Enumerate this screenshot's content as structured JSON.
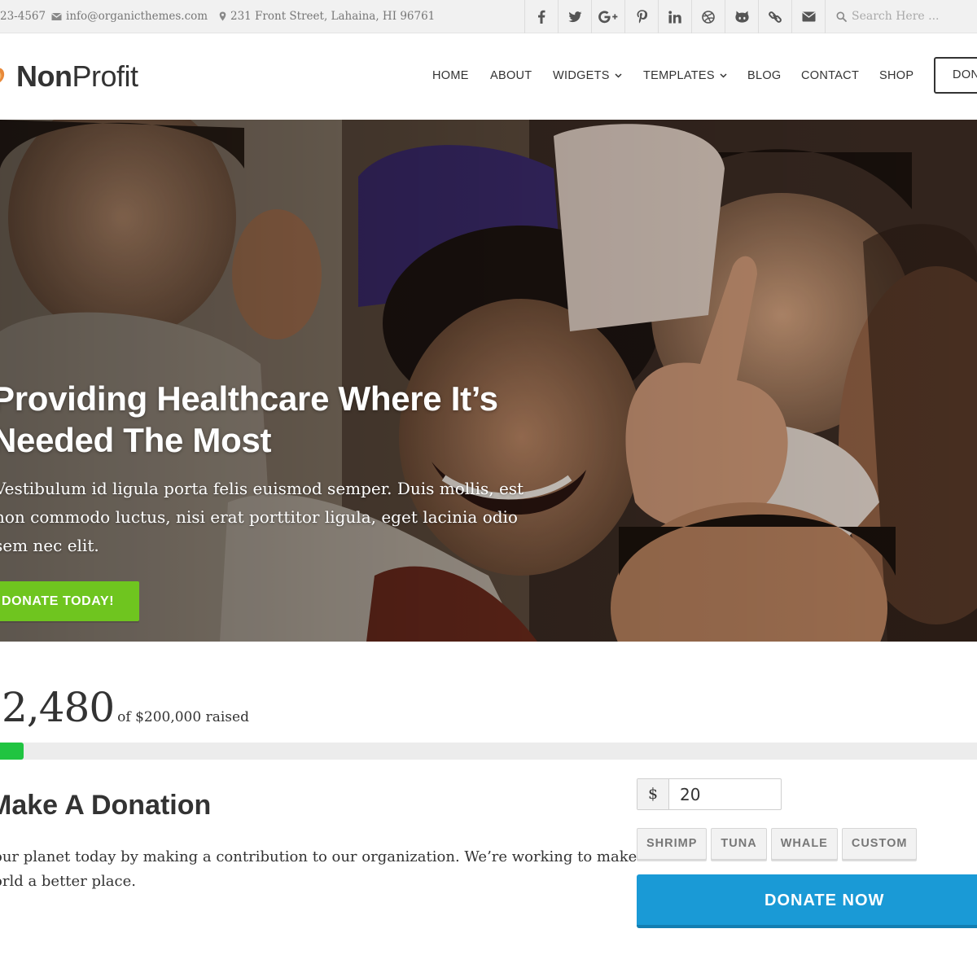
{
  "topbar": {
    "phone": "23-4567",
    "email": "info@organicthemes.com",
    "address": "231 Front Street, Lahaina, HI 96761",
    "social": [
      "facebook-icon",
      "twitter-icon",
      "google-plus-icon",
      "pinterest-icon",
      "linkedin-icon",
      "dribbble-icon",
      "github-icon",
      "link-icon",
      "envelope-icon"
    ],
    "search_placeholder": "Search Here ..."
  },
  "header": {
    "logo_bold": "Non",
    "logo_light": "Profit",
    "nav": {
      "home": "HOME",
      "about": "ABOUT",
      "widgets": "WIDGETS",
      "templates": "TEMPLATES",
      "blog": "BLOG",
      "contact": "CONTACT",
      "shop": "SHOP",
      "donate": "DON"
    }
  },
  "hero": {
    "title_line1": "Providing Healthcare Where It’s",
    "title_line2": "Needed The Most",
    "text_line1": "Vestibulum id ligula porta felis euismod semper. Duis mollis, est",
    "text_line2": "non commodo luctus, nisi erat porttitor ligula, eget lacinia odio",
    "text_line3": "sem nec elit.",
    "button": "DONATE TODAY!"
  },
  "campaign": {
    "raised_display": "2,480",
    "goal_text": "of $200,000 raised",
    "progress_percent": 2.4
  },
  "donation": {
    "title": "Make A Donation",
    "text_line1": "our planet today by making a contribution to our organization. We’re working to make",
    "text_line2": "orld a better place.",
    "currency": "$",
    "amount": "20",
    "levels": {
      "shrimp": "SHRIMP",
      "tuna": "TUNA",
      "whale": "WHALE",
      "custom": "CUSTOM"
    },
    "button": "DONATE NOW"
  },
  "colors": {
    "accent_green": "#6fc51f",
    "progress_green": "#20c441",
    "donate_blue": "#1a9ad6"
  }
}
